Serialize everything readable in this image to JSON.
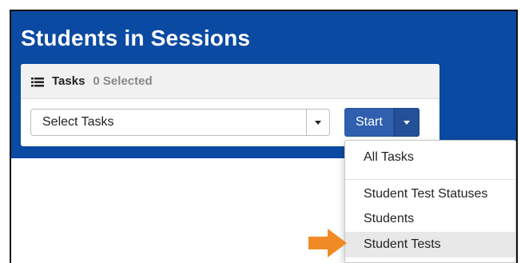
{
  "header": {
    "title": "Students in Sessions"
  },
  "tasks_panel": {
    "icon": "list-icon",
    "label": "Tasks",
    "selected_text": "0 Selected",
    "select": {
      "value": "Select Tasks"
    },
    "start_button": "Start"
  },
  "dropdown": {
    "items": [
      {
        "label": "All Tasks"
      },
      {
        "label": "Student Test Statuses"
      },
      {
        "label": "Students"
      },
      {
        "label": "Student Tests"
      }
    ],
    "highlighted": "Student Tests"
  },
  "colors": {
    "banner": "#0b4aa2",
    "start_button": "#2f5fae",
    "arrow": "#f08a24"
  }
}
